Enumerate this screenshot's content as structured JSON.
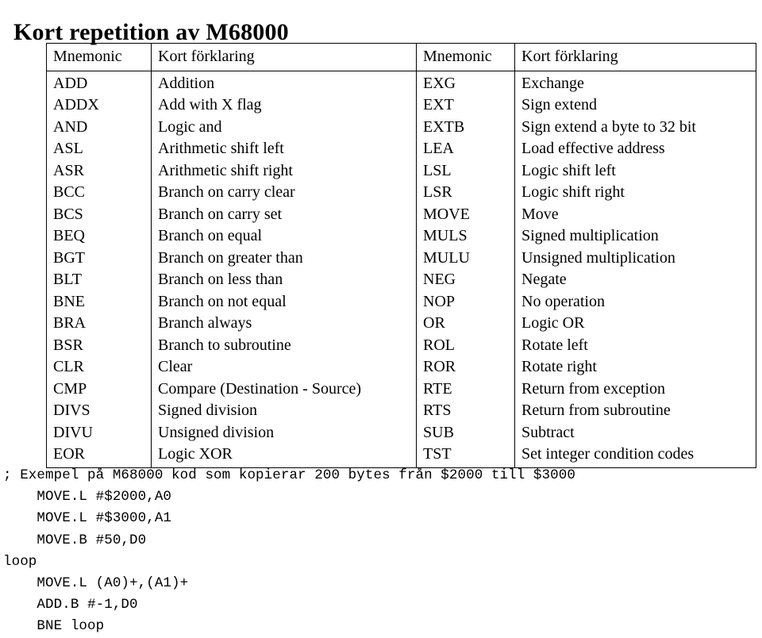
{
  "document": {
    "title": "Kort repetition av M68000"
  },
  "table": {
    "headers": {
      "left_mnemonic": "Mnemonic",
      "left_description": "Kort förklaring",
      "right_mnemonic": "Mnemonic",
      "right_description": "Kort förklaring"
    },
    "rows": [
      {
        "lm": "ADD",
        "ld": "Addition",
        "rm": "EXG",
        "rd": "Exchange"
      },
      {
        "lm": "ADDX",
        "ld": "Add with X flag",
        "rm": "EXT",
        "rd": "Sign extend"
      },
      {
        "lm": "AND",
        "ld": "Logic and",
        "rm": "EXTB",
        "rd": "Sign extend a byte to 32 bit"
      },
      {
        "lm": "ASL",
        "ld": "Arithmetic shift left",
        "rm": "LEA",
        "rd": "Load effective address"
      },
      {
        "lm": "ASR",
        "ld": "Arithmetic shift right",
        "rm": "LSL",
        "rd": "Logic shift left"
      },
      {
        "lm": "BCC",
        "ld": "Branch on carry clear",
        "rm": "LSR",
        "rd": "Logic shift right"
      },
      {
        "lm": "BCS",
        "ld": "Branch on carry set",
        "rm": "MOVE",
        "rd": "Move"
      },
      {
        "lm": "BEQ",
        "ld": "Branch on equal",
        "rm": "MULS",
        "rd": "Signed multiplication"
      },
      {
        "lm": "BGT",
        "ld": "Branch on greater than",
        "rm": "MULU",
        "rd": "Unsigned multiplication"
      },
      {
        "lm": "BLT",
        "ld": "Branch on less than",
        "rm": "NEG",
        "rd": "Negate"
      },
      {
        "lm": "BNE",
        "ld": "Branch on not equal",
        "rm": "NOP",
        "rd": "No operation"
      },
      {
        "lm": "BRA",
        "ld": "Branch always",
        "rm": "OR",
        "rd": "Logic OR"
      },
      {
        "lm": "BSR",
        "ld": "Branch to subroutine",
        "rm": "ROL",
        "rd": "Rotate left"
      },
      {
        "lm": "CLR",
        "ld": "Clear",
        "rm": "ROR",
        "rd": "Rotate right"
      },
      {
        "lm": "CMP",
        "ld": "Compare (Destination - Source)",
        "rm": "RTE",
        "rd": "Return from exception"
      },
      {
        "lm": "DIVS",
        "ld": "Signed division",
        "rm": "RTS",
        "rd": "Return from subroutine"
      },
      {
        "lm": "DIVU",
        "ld": "Unsigned division",
        "rm": "SUB",
        "rd": "Subtract"
      },
      {
        "lm": "EOR",
        "ld": "Logic XOR",
        "rm": "TST",
        "rd": "Set integer condition codes"
      }
    ]
  },
  "code": {
    "lines": [
      "; Exempel på M68000 kod som kopierar 200 bytes från $2000 till $3000",
      "    MOVE.L #$2000,A0",
      "    MOVE.L #$3000,A1",
      "    MOVE.B #50,D0",
      "loop",
      "    MOVE.L (A0)+,(A1)+",
      "    ADD.B #-1,D0",
      "    BNE loop"
    ]
  }
}
